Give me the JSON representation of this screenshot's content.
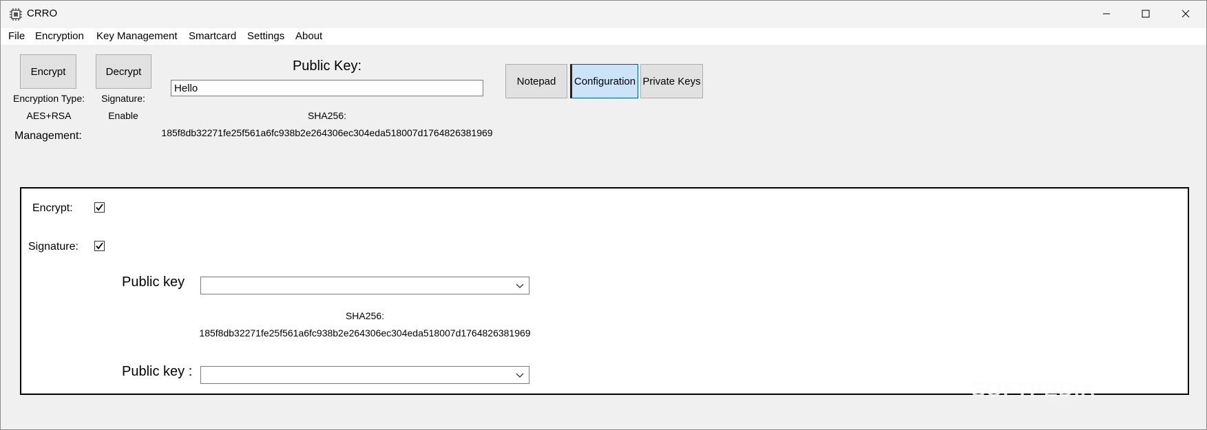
{
  "window": {
    "title": "CRRO"
  },
  "menu": {
    "items": [
      "File",
      "Encryption",
      "Key Management",
      "Smartcard",
      "Settings",
      "About"
    ]
  },
  "toolbar": {
    "encrypt_label": "Encrypt",
    "decrypt_label": "Decrypt",
    "encryption_type_label": "Encryption Type:",
    "encryption_type_value": "AES+RSA",
    "signature_label": "Signature:",
    "signature_value": "Enable",
    "management_label": "Management:",
    "public_key_heading": "Public Key:",
    "public_key_value": "Hello",
    "sha_label": "SHA256:",
    "sha_value": "185f8db32271fe25f561a6fc938b2e264306ec304eda518007d1764826381969"
  },
  "tabs": {
    "notepad": "Notepad",
    "configuration": "Configuration",
    "private_keys": "Private Keys",
    "active": "Configuration"
  },
  "config_panel": {
    "encrypt_label": "Encrypt:",
    "encrypt_checked": true,
    "signature_label": "Signature:",
    "signature_checked": true,
    "public_key_label_1": "Public key",
    "public_key_value_1": "",
    "sha_label": "SHA256:",
    "sha_value": "185f8db32271fe25f561a6fc938b2e264306ec304eda518007d1764826381969",
    "public_key_label_2": "Public key :",
    "public_key_value_2": ""
  },
  "watermark": "SOFTPEDIA",
  "colors": {
    "window_bg": "#f0f0f0",
    "active_tab": "#cce4f7",
    "button_bg": "#e1e1e1"
  },
  "icons": {
    "app": "chip-icon",
    "minimize": "minimize-icon",
    "maximize": "maximize-icon",
    "close": "close-icon",
    "dropdown": "chevron-down-icon",
    "check": "check-icon"
  }
}
